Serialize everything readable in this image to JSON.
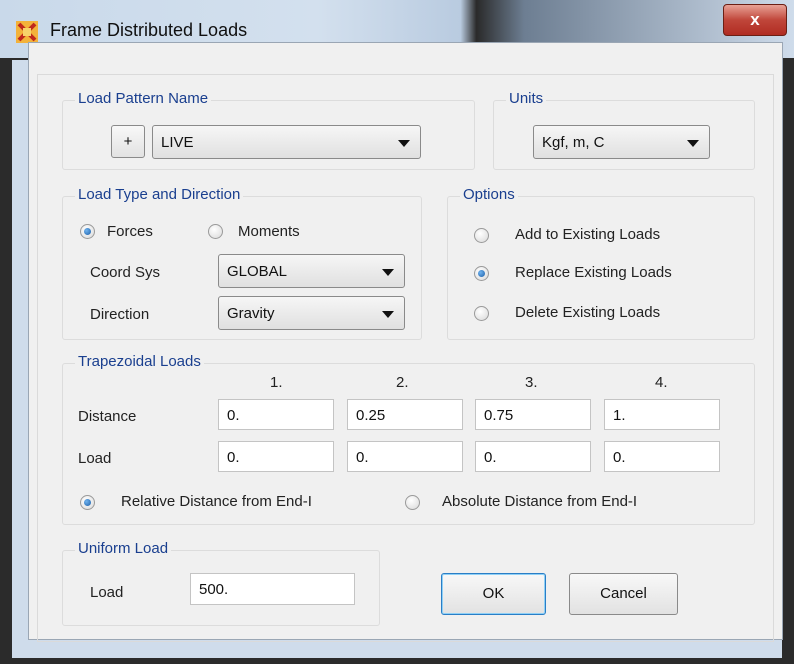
{
  "window": {
    "title": "Frame Distributed Loads",
    "close_glyph": "x",
    "icon": "csi-app-icon"
  },
  "load_pattern": {
    "group_title": "Load Pattern Name",
    "add_label": "+",
    "value": "LIVE"
  },
  "units": {
    "group_title": "Units",
    "value": "Kgf, m, C"
  },
  "load_type": {
    "group_title": "Load Type and Direction",
    "forces_label": "Forces",
    "moments_label": "Moments",
    "selected": "Forces",
    "coord_sys_label": "Coord Sys",
    "coord_sys_value": "GLOBAL",
    "direction_label": "Direction",
    "direction_value": "Gravity"
  },
  "options": {
    "group_title": "Options",
    "items": [
      "Add to Existing Loads",
      "Replace Existing Loads",
      "Delete Existing Loads"
    ],
    "selected": "Replace Existing Loads"
  },
  "trapezoidal": {
    "group_title": "Trapezoidal Loads",
    "columns": [
      "1.",
      "2.",
      "3.",
      "4."
    ],
    "distance_label": "Distance",
    "load_label": "Load",
    "distance_values": [
      "0.",
      "0.25",
      "0.75",
      "1."
    ],
    "load_values": [
      "0.",
      "0.",
      "0.",
      "0."
    ],
    "relative_label": "Relative Distance from End-I",
    "absolute_label": "Absolute Distance from End-I",
    "selected": "Relative Distance from End-I"
  },
  "uniform": {
    "group_title": "Uniform Load",
    "load_label": "Load",
    "load_value": "500."
  },
  "buttons": {
    "ok": "OK",
    "cancel": "Cancel"
  }
}
